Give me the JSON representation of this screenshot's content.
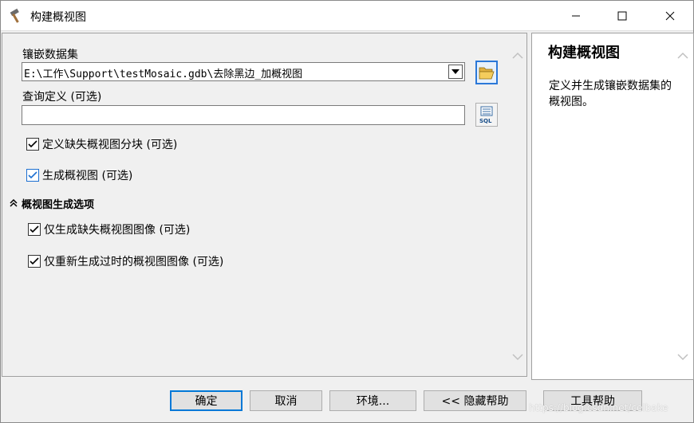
{
  "window": {
    "title": "构建概视图",
    "icon": "hammer-icon",
    "controls": {
      "minimize": "minimize-icon",
      "maximize": "maximize-icon",
      "close": "close-icon"
    }
  },
  "form": {
    "mosaic_label": "镶嵌数据集",
    "mosaic_value": "E:\\工作\\Support\\testMosaic.gdb\\去除黑边_加概视图",
    "query_label": "查询定义 (可选)",
    "query_value": "",
    "define_missing_label": "定义缺失概视图分块 (可选)",
    "define_missing_checked": true,
    "generate_label": "生成概视图 (可选)",
    "generate_checked": true,
    "section_label": "概视图生成选项",
    "only_missing_label": "仅生成缺失概视图图像 (可选)",
    "only_missing_checked": true,
    "regenerate_stale_label": "仅重新生成过时的概视图图像 (可选)",
    "regenerate_stale_checked": true
  },
  "help": {
    "title": "构建概视图",
    "body": "定义并生成镶嵌数据集的概视图。"
  },
  "buttons": {
    "ok": "确定",
    "cancel": "取消",
    "environments": "环境...",
    "hide_help": "<< 隐藏帮助",
    "tool_help": "工具帮助"
  },
  "watermark": "https://blog.csdn.net/celbake",
  "colors": {
    "accent": "#0078d7",
    "checkbox_blue": "#1c6fd1"
  }
}
